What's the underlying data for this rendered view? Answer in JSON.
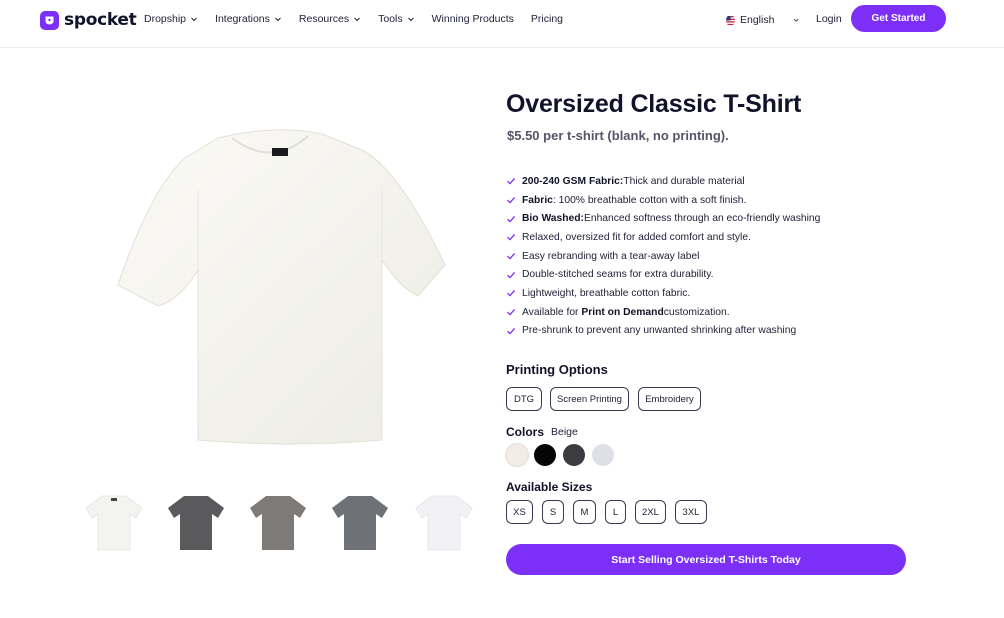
{
  "nav": {
    "brand": "spocket",
    "menu": [
      {
        "label": "Dropship",
        "dropdown": true
      },
      {
        "label": "Integrations",
        "dropdown": true
      },
      {
        "label": "Resources",
        "dropdown": true
      },
      {
        "label": "Tools",
        "dropdown": true
      },
      {
        "label": "Winning Products",
        "dropdown": false
      },
      {
        "label": "Pricing",
        "dropdown": false
      }
    ],
    "language": "English",
    "login": "Login",
    "cta": "Get Started"
  },
  "product": {
    "title": "Oversized Classic T-Shirt",
    "price": "$5.50 per t-shirt (blank, no printing).",
    "features": [
      {
        "bold": "200-240 GSM Fabric:",
        "text": " Thick and durable material"
      },
      {
        "bold": "Fabric",
        "text": ": 100% breathable cotton with a soft finish."
      },
      {
        "bold": "Bio Washed:",
        "text": " Enhanced softness through an eco-friendly washing"
      },
      {
        "bold": "",
        "text": "Relaxed, oversized fit for added comfort and style."
      },
      {
        "bold": "",
        "text": "Easy rebranding with a tear-away label"
      },
      {
        "bold": "",
        "text": "Double-stitched seams for extra durability."
      },
      {
        "bold": "",
        "text": "Lightweight, breathable cotton fabric."
      },
      {
        "pre": "Available for ",
        "bold": "Print on Demand",
        "text": " customization."
      },
      {
        "bold": "",
        "text": "Pre-shrunk to prevent any unwanted shrinking after washing"
      }
    ],
    "printing": {
      "title": "Printing Options",
      "options": [
        "DTG",
        "Screen Printing",
        "Embroidery"
      ]
    },
    "colors": {
      "title": "Colors",
      "selected": "Beige",
      "swatches": [
        "#f1ede5",
        "#050505",
        "#3c3b40",
        "#dde0e6"
      ]
    },
    "sizes": {
      "title": "Available Sizes",
      "options": [
        "XS",
        "S",
        "M",
        "L",
        "2XL",
        "3XL"
      ]
    },
    "cta": "Start Selling Oversized T-Shirts Today",
    "thumbnails": [
      {
        "color": "#f3f3f1"
      },
      {
        "color": "#5a5a5c"
      },
      {
        "color": "#7e7a78"
      },
      {
        "color": "#6e7276"
      },
      {
        "color": "#f2f1f4"
      }
    ]
  },
  "colors": {
    "accent": "#7b2ff7",
    "text": "#12122a"
  }
}
